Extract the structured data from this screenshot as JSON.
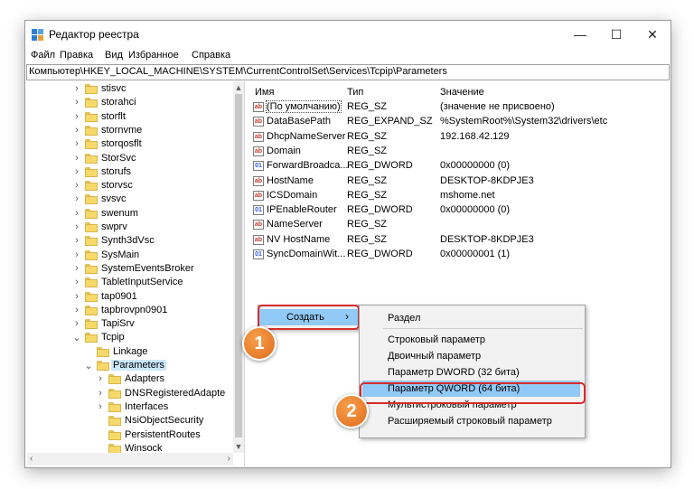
{
  "window": {
    "title": "Редактор реестра",
    "controls": {
      "minimize": "—",
      "maximize": "☐",
      "close": "✕"
    }
  },
  "menu": [
    "Файл",
    "Правка",
    "Вид",
    "Избранное",
    "Справка"
  ],
  "address": "Компьютер\\HKEY_LOCAL_MACHINE\\SYSTEM\\CurrentControlSet\\Services\\Tcpip\\Parameters",
  "tree": {
    "items": [
      {
        "label": "stisvc",
        "level": 1,
        "chevron": "›"
      },
      {
        "label": "storahci",
        "level": 1,
        "chevron": "›"
      },
      {
        "label": "storflt",
        "level": 1,
        "chevron": "›"
      },
      {
        "label": "stornvme",
        "level": 1,
        "chevron": "›"
      },
      {
        "label": "storqosflt",
        "level": 1,
        "chevron": "›"
      },
      {
        "label": "StorSvc",
        "level": 1,
        "chevron": "›"
      },
      {
        "label": "storufs",
        "level": 1,
        "chevron": "›"
      },
      {
        "label": "storvsc",
        "level": 1,
        "chevron": "›"
      },
      {
        "label": "svsvc",
        "level": 1,
        "chevron": "›"
      },
      {
        "label": "swenum",
        "level": 1,
        "chevron": "›"
      },
      {
        "label": "swprv",
        "level": 1,
        "chevron": "›"
      },
      {
        "label": "Synth3dVsc",
        "level": 1,
        "chevron": "›"
      },
      {
        "label": "SysMain",
        "level": 1,
        "chevron": "›"
      },
      {
        "label": "SystemEventsBroker",
        "level": 1,
        "chevron": "›"
      },
      {
        "label": "TabletInputService",
        "level": 1,
        "chevron": "›"
      },
      {
        "label": "tap0901",
        "level": 1,
        "chevron": "›"
      },
      {
        "label": "tapbrovpn0901",
        "level": 1,
        "chevron": "›"
      },
      {
        "label": "TapiSrv",
        "level": 1,
        "chevron": "›"
      },
      {
        "label": "Tcpip",
        "level": 1,
        "chevron": "⌄"
      },
      {
        "label": "Linkage",
        "level": 2,
        "chevron": ""
      },
      {
        "label": "Parameters",
        "level": 2,
        "chevron": "⌄",
        "selected": true
      },
      {
        "label": "Adapters",
        "level": 3,
        "chevron": "›"
      },
      {
        "label": "DNSRegisteredAdapte",
        "level": 3,
        "chevron": "›"
      },
      {
        "label": "Interfaces",
        "level": 3,
        "chevron": "›"
      },
      {
        "label": "NsiObjectSecurity",
        "level": 3,
        "chevron": ""
      },
      {
        "label": "PersistentRoutes",
        "level": 3,
        "chevron": ""
      },
      {
        "label": "Winsock",
        "level": 3,
        "chevron": ""
      }
    ]
  },
  "scroll": {
    "up": "▲",
    "down": "▼",
    "left": "‹",
    "right": "›"
  },
  "values": {
    "headers": {
      "name": "Имя",
      "type": "Тип",
      "data": "Значение"
    },
    "rows": [
      {
        "icon": "string",
        "icon_text": "ab",
        "name": "(По умолчанию)",
        "type": "REG_SZ",
        "data": "(значение не присвоено)"
      },
      {
        "icon": "string",
        "icon_text": "ab",
        "name": "DataBasePath",
        "type": "REG_EXPAND_SZ",
        "data": "%SystemRoot%\\System32\\drivers\\etc"
      },
      {
        "icon": "string",
        "icon_text": "ab",
        "name": "DhcpNameServer",
        "type": "REG_SZ",
        "data": "192.168.42.129"
      },
      {
        "icon": "string",
        "icon_text": "ab",
        "name": "Domain",
        "type": "REG_SZ",
        "data": ""
      },
      {
        "icon": "binary",
        "icon_text": "01",
        "name": "ForwardBroadca...",
        "type": "REG_DWORD",
        "data": "0x00000000 (0)"
      },
      {
        "icon": "string",
        "icon_text": "ab",
        "name": "HostName",
        "type": "REG_SZ",
        "data": "DESKTOP-8KDPJE3"
      },
      {
        "icon": "string",
        "icon_text": "ab",
        "name": "ICSDomain",
        "type": "REG_SZ",
        "data": "mshome.net"
      },
      {
        "icon": "binary",
        "icon_text": "01",
        "name": "IPEnableRouter",
        "type": "REG_DWORD",
        "data": "0x00000000 (0)"
      },
      {
        "icon": "string",
        "icon_text": "ab",
        "name": "NameServer",
        "type": "REG_SZ",
        "data": ""
      },
      {
        "icon": "string",
        "icon_text": "ab",
        "name": "NV HostName",
        "type": "REG_SZ",
        "data": "DESKTOP-8KDPJE3"
      },
      {
        "icon": "binary",
        "icon_text": "01",
        "name": "SyncDomainWit...",
        "type": "REG_DWORD",
        "data": "0x00000001 (1)"
      }
    ]
  },
  "context_menu": {
    "label": "Создать",
    "arrow": "›"
  },
  "submenu": {
    "items": [
      "Раздел",
      "Строковый параметр",
      "Двоичный параметр",
      "Параметр DWORD (32 бита)",
      "Параметр QWORD (64 бита)",
      "Мультистроковый параметр",
      "Расширяемый строковый параметр"
    ],
    "highlighted_index": 4
  },
  "badges": [
    "1",
    "2"
  ],
  "colors": {
    "highlight": "#91c9f7",
    "annotation_red": "#d92b2b",
    "badge_orange": "#e8782a"
  }
}
